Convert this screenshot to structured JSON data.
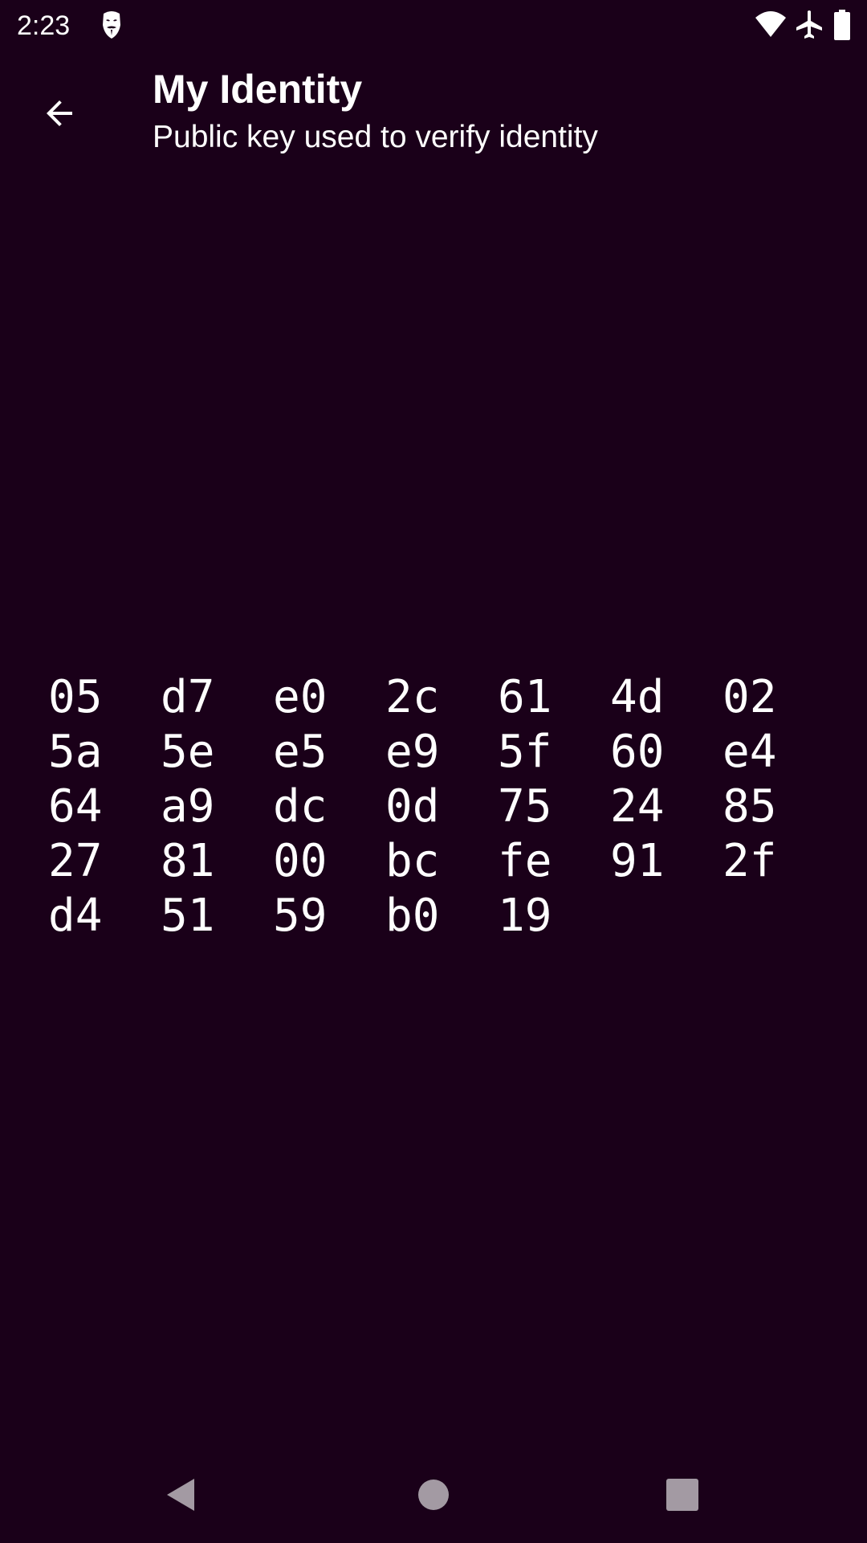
{
  "status_bar": {
    "time": "2:23",
    "icons": [
      "anonymous-mask-icon",
      "wifi-icon",
      "airplane-mode-icon",
      "battery-icon"
    ]
  },
  "app_bar": {
    "title": "My Identity",
    "subtitle": "Public key used to verify identity",
    "back_icon": "arrow-back-icon"
  },
  "public_key": {
    "bytes": [
      "05",
      "d7",
      "e0",
      "2c",
      "61",
      "4d",
      "02",
      "5a",
      "5e",
      "e5",
      "e9",
      "5f",
      "60",
      "e4",
      "64",
      "a9",
      "dc",
      "0d",
      "75",
      "24",
      "85",
      "27",
      "81",
      "00",
      "bc",
      "fe",
      "91",
      "2f",
      "d4",
      "51",
      "59",
      "b0",
      "19"
    ]
  },
  "nav_bar": {
    "icons": [
      "back-triangle-icon",
      "home-circle-icon",
      "recents-square-icon"
    ]
  },
  "colors": {
    "background": "#1a0019",
    "text": "#ffffff",
    "nav_icons": "#a39aa3"
  }
}
